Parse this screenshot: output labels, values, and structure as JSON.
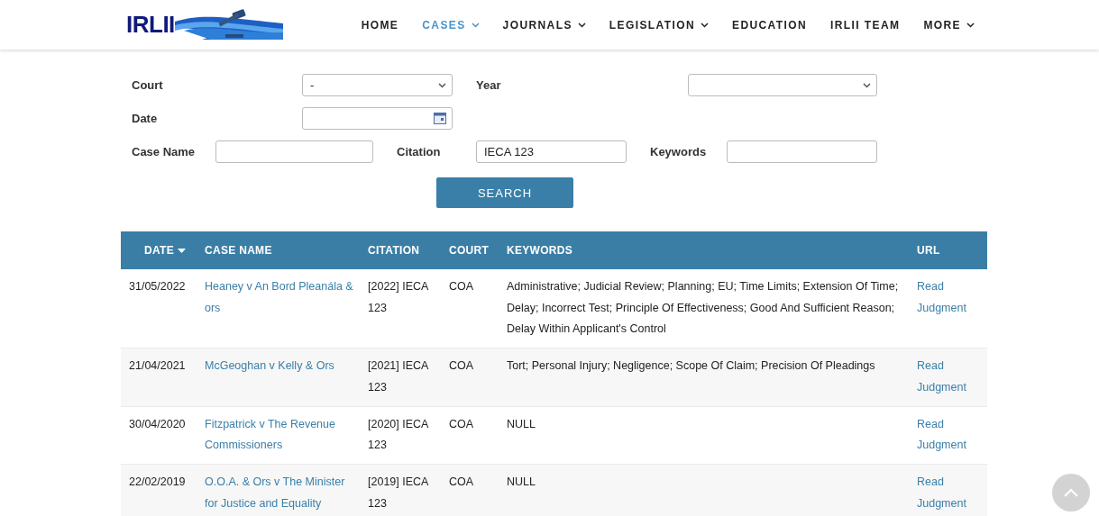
{
  "logo": {
    "text": "IRLII"
  },
  "nav": [
    {
      "label": "HOME",
      "selected": false,
      "dropdown": false
    },
    {
      "label": "CASES",
      "selected": true,
      "dropdown": true
    },
    {
      "label": "JOURNALS",
      "selected": false,
      "dropdown": true
    },
    {
      "label": "LEGISLATION",
      "selected": false,
      "dropdown": true
    },
    {
      "label": "EDUCATION",
      "selected": false,
      "dropdown": false
    },
    {
      "label": "IRLII TEAM",
      "selected": false,
      "dropdown": false
    },
    {
      "label": "MORE",
      "selected": false,
      "dropdown": true
    }
  ],
  "form": {
    "court": {
      "label": "Court",
      "value": "-"
    },
    "year": {
      "label": "Year"
    },
    "date": {
      "label": "Date"
    },
    "case_name": {
      "label": "Case Name"
    },
    "citation": {
      "label": "Citation",
      "value": "IECA 123"
    },
    "keywords": {
      "label": "Keywords"
    },
    "search_button": "SEARCH"
  },
  "table": {
    "columns": [
      {
        "label": "DATE",
        "sorted": true
      },
      {
        "label": "CASE NAME",
        "sorted": false
      },
      {
        "label": "CITATION",
        "sorted": false
      },
      {
        "label": "COURT",
        "sorted": false
      },
      {
        "label": "KEYWORDS",
        "sorted": false
      },
      {
        "label": "URL",
        "sorted": false
      }
    ],
    "rows": [
      {
        "date": "31/05/2022",
        "case_name": "Heaney v An Bord Pleanála & ors",
        "citation": "[2022] IECA 123",
        "court": "COA",
        "keywords": "Administrative; Judicial Review; Planning; EU; Time Limits; Extension Of Time; Delay; Incorrect Test; Principle Of Effectiveness; Good And Sufficient Reason; Delay Within Applicant's Control",
        "url": "Read Judgment"
      },
      {
        "date": "21/04/2021",
        "case_name": "McGeoghan v Kelly & Ors",
        "citation": "[2021] IECA 123",
        "court": "COA",
        "keywords": "Tort; Personal Injury; Negligence; Scope Of Claim; Precision Of Pleadings",
        "url": "Read Judgment"
      },
      {
        "date": "30/04/2020",
        "case_name": "Fitzpatrick v The Revenue Commissioners",
        "citation": "[2020] IECA 123",
        "court": "COA",
        "keywords": "NULL",
        "url": "Read Judgment"
      },
      {
        "date": "22/02/2019",
        "case_name": "O.O.A. & Ors v The Minister for Justice and Equality",
        "citation": "[2019] IECA 123",
        "court": "COA",
        "keywords": "NULL",
        "url": "Read Judgment"
      }
    ]
  }
}
